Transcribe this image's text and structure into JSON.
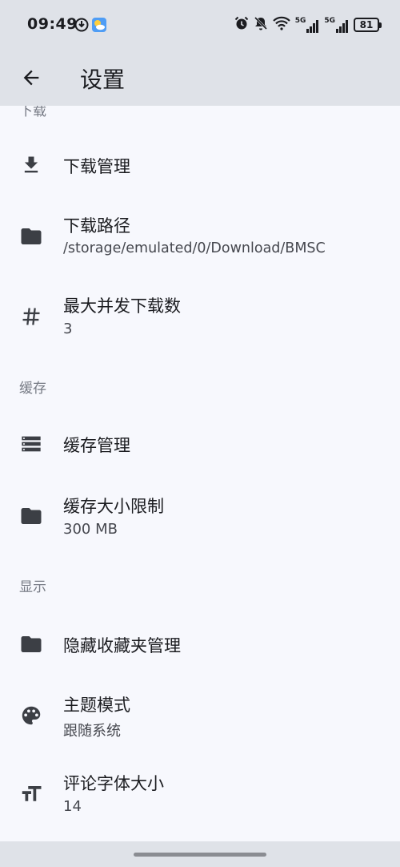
{
  "status_bar": {
    "time": "09:49",
    "network_5g_1": "5G",
    "network_5g_2": "5G",
    "wifi_label": "6",
    "battery": "81"
  },
  "app_bar": {
    "title": "设置"
  },
  "sections": {
    "download_partial": "下载",
    "cache": "缓存",
    "display": "显示"
  },
  "items": {
    "download_manage": {
      "title": "下载管理"
    },
    "download_path": {
      "title": "下载路径",
      "subtitle": "/storage/emulated/0/Download/BMSC"
    },
    "max_concurrent": {
      "title": "最大并发下载数",
      "subtitle": "3"
    },
    "cache_manage": {
      "title": "缓存管理"
    },
    "cache_limit": {
      "title": "缓存大小限制",
      "subtitle": "300 MB"
    },
    "hidden_fav": {
      "title": "隐藏收藏夹管理"
    },
    "theme_mode": {
      "title": "主题模式",
      "subtitle": "跟随系统"
    },
    "comment_font": {
      "title": "评论字体大小",
      "subtitle": "14"
    }
  },
  "icons": {
    "back": "arrow-back-icon",
    "download": "download-icon",
    "folder": "folder-icon",
    "hash": "hash-icon",
    "list": "storage-list-icon",
    "palette": "palette-icon",
    "text_size": "text-size-icon"
  },
  "colors": {
    "bar_bg": "#dfe2e8",
    "content_bg": "#f7f8fd",
    "icon": "#3c3f45",
    "section_header": "#767a84"
  }
}
